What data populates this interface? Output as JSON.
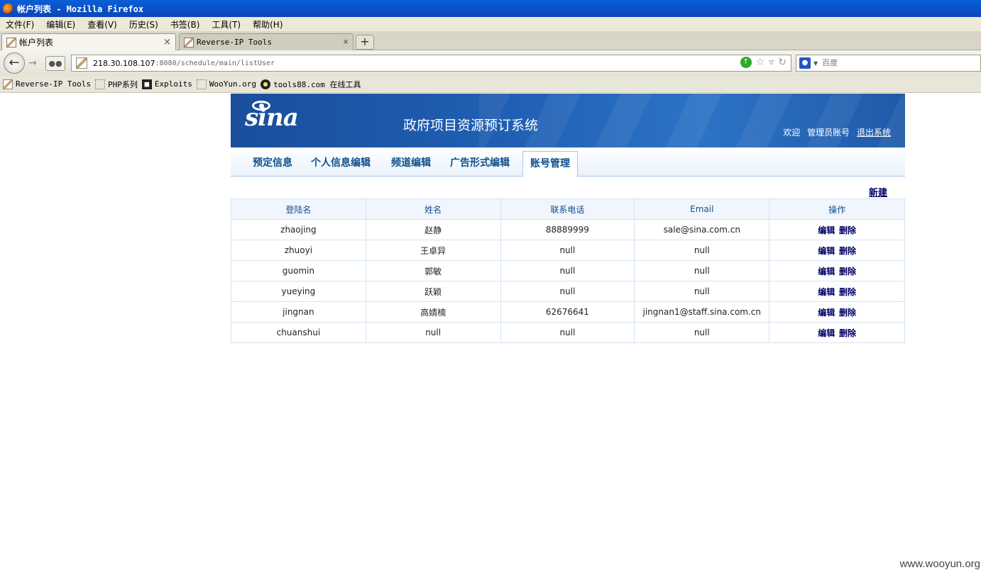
{
  "window": {
    "title": "帐户列表 - Mozilla Firefox"
  },
  "menubar": {
    "items": [
      "文件(F)",
      "编辑(E)",
      "查看(V)",
      "历史(S)",
      "书签(B)",
      "工具(T)",
      "帮助(H)"
    ]
  },
  "tabs": [
    {
      "label": "帐户列表",
      "close": "×"
    },
    {
      "label": "Reverse-IP Tools",
      "close": "×"
    }
  ],
  "newtab_label": "+",
  "navbar": {
    "url_host": "218.30.108.107",
    "url_path": ":8080/schedule/main/listUser",
    "search_placeholder": "百度"
  },
  "bookmarks": [
    {
      "label": "Reverse-IP Tools",
      "icon": "pen-icon"
    },
    {
      "label": "PHP系列",
      "icon": "folder-icon"
    },
    {
      "label": "Exploits",
      "icon": "exploit-icon"
    },
    {
      "label": "WooYun.org",
      "icon": "folder-icon"
    },
    {
      "label": "tools88.com 在线工具",
      "icon": "radiation-icon"
    }
  ],
  "app": {
    "logo_text": "sina",
    "system_title": "政府项目资源预订系统",
    "welcome": "欢迎",
    "account": "管理员账号",
    "logout": "退出系统",
    "nav": [
      "预定信息",
      "个人信息编辑",
      "频道编辑",
      "广告形式编辑",
      "账号管理"
    ],
    "active_nav": "账号管理",
    "new_link": "新建",
    "table": {
      "headers": [
        "登陆名",
        "姓名",
        "联系电话",
        "Email",
        "操作"
      ],
      "rows": [
        {
          "login": "zhaojing",
          "name": "赵静",
          "phone": "88889999",
          "email": "sale@sina.com.cn"
        },
        {
          "login": "zhuoyi",
          "name": "王卓异",
          "phone": "null",
          "email": "null"
        },
        {
          "login": "guomin",
          "name": "郭敏",
          "phone": "null",
          "email": "null"
        },
        {
          "login": "yueying",
          "name": "跃颖",
          "phone": "null",
          "email": "null"
        },
        {
          "login": "jingnan",
          "name": "高婧楠",
          "phone": "62676641",
          "email": "jingnan1@staff.sina.com.cn"
        },
        {
          "login": "chuanshui",
          "name": "null",
          "phone": "null",
          "email": "null"
        }
      ],
      "op_edit": "编辑",
      "op_delete": "删除"
    }
  },
  "watermark": "www.wooyun.org"
}
